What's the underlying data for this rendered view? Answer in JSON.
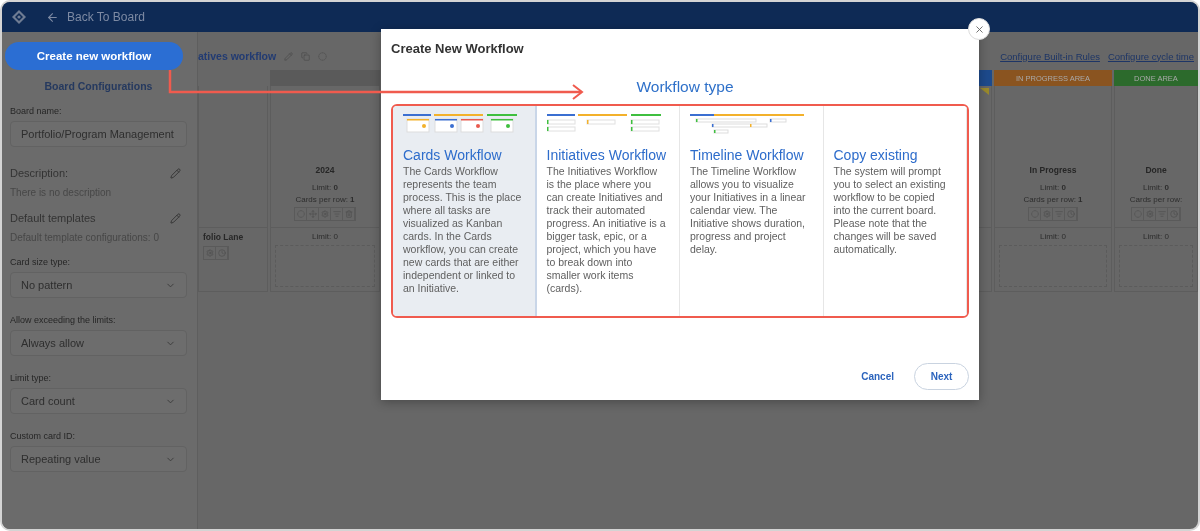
{
  "topbar": {
    "back_label": "Back To Board"
  },
  "sidebar": {
    "create_button": "Create new workflow",
    "section_title": "Board Configurations",
    "fields": [
      {
        "kind": "input",
        "label": "Board name:",
        "value": "Portfolio/Program Management"
      },
      {
        "kind": "note",
        "label": "Description:",
        "text": "There is no description"
      },
      {
        "kind": "note",
        "label": "Default templates",
        "text": "Default template configurations: 0"
      },
      {
        "kind": "select",
        "label": "Card size type:",
        "value": "No pattern"
      },
      {
        "kind": "select",
        "label": "Allow exceeding the limits:",
        "value": "Always allow"
      },
      {
        "kind": "select",
        "label": "Limit type:",
        "value": "Card count"
      },
      {
        "kind": "select",
        "label": "Custom card ID:",
        "value": "Repeating value"
      }
    ]
  },
  "board": {
    "title": "atives workflow",
    "links": [
      "Configure Built-in Rules",
      "Configure cycle time"
    ],
    "lane": {
      "label": "folio Lane"
    },
    "left_columns": [
      {
        "color": "#5a5a5a",
        "title": "2024",
        "limit": "Limit: **0**",
        "cards_per_row": "Cards per row: **1**",
        "lane_limit": "Limit: 0"
      }
    ],
    "right_columns": [
      {
        "color": "#1d4a8c",
        "marker": true
      },
      {
        "color": "#8a5420",
        "header": "IN PROGRESS AREA",
        "title": "In Progress",
        "limit": "Limit: **0**",
        "cards_per_row": "Cards per row: **1**",
        "lane_limit": "Limit: 0"
      },
      {
        "color": "#2c6a2c",
        "header": "DONE AREA",
        "title": "Done",
        "limit": "Limit: **0**",
        "cards_per_row": "Cards per row:",
        "lane_limit": "Limit: 0"
      }
    ]
  },
  "modal": {
    "title": "Create New Workflow",
    "section_label": "Workflow type",
    "options": [
      {
        "kind": "cards",
        "title": "Cards Workflow",
        "description": "The Cards Workflow represents the team process. This is the place where all tasks are visualized as Kanban cards. In the Cards workflow, you can create new cards that are either independent or linked to an Initiative.",
        "selected": true
      },
      {
        "kind": "initiatives",
        "title": "Initiatives Workflow",
        "description": "The Initiatives Workflow is the place where you can create Initiatives and track their automated progress. An initiative is a bigger task, epic, or a project, which you have to break down into smaller work items (cards).",
        "selected": false
      },
      {
        "kind": "timeline",
        "title": "Timeline Workflow",
        "description": "The Timeline Workflow allows you to visualize your Initiatives in a linear calendar view. The Initiative shows duration, progress and project delay.",
        "selected": false
      },
      {
        "kind": "copy",
        "title": "Copy existing",
        "description": "The system will prompt you to select an existing workflow to be copied into the current board. Please note that the changes will be saved automatically.",
        "selected": false
      }
    ],
    "cancel": "Cancel",
    "next": "Next"
  }
}
